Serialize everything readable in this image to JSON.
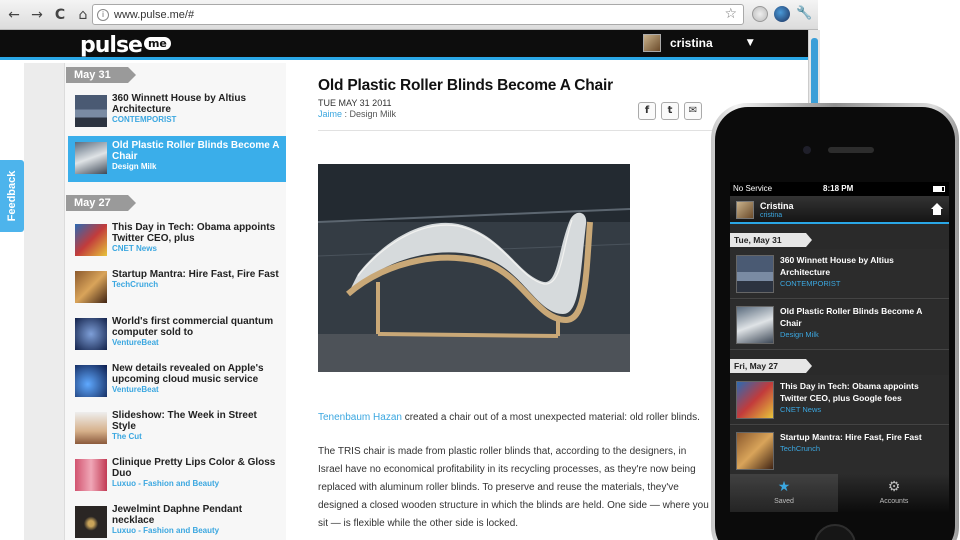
{
  "browser": {
    "url": "www.pulse.me/#",
    "back_icon": "←",
    "forward_icon": "→",
    "reload_icon": "C",
    "home_icon": "⌂",
    "star_icon": "☆",
    "wrench_icon": "🔧"
  },
  "header": {
    "logo_text": "pulse",
    "logo_badge": "me",
    "user_name": "cristina",
    "caret_icon": "▼"
  },
  "feedback": {
    "label": "Feedback"
  },
  "sidebar": {
    "date_1": "May 31",
    "date_2": "May 27",
    "stories": [
      {
        "title": "360 Winnett House by Altius Architecture",
        "source": "CONTEMPORIST",
        "thumb": "house"
      },
      {
        "title": "Old Plastic Roller Blinds Become A Chair",
        "source": "Design Milk",
        "thumb": "chair",
        "selected": true
      },
      {
        "title": "This Day in Tech: Obama appoints Twitter CEO, plus",
        "source": "CNET News",
        "thumb": "news"
      },
      {
        "title": "Startup Mantra: Hire Fast, Fire Fast",
        "source": "TechCrunch",
        "thumb": "startup"
      },
      {
        "title": "World's first commercial quantum computer sold to",
        "source": "VentureBeat",
        "thumb": "quantum"
      },
      {
        "title": "New details revealed on Apple's upcoming cloud music service",
        "source": "VentureBeat",
        "thumb": "cloud"
      },
      {
        "title": "Slideshow: The Week in Street Style",
        "source": "The Cut",
        "thumb": "street"
      },
      {
        "title": "Clinique Pretty Lips Color & Gloss Duo",
        "source": "Luxuo - Fashion and Beauty",
        "thumb": "lips"
      },
      {
        "title": "Jewelmint Daphne Pendant necklace",
        "source": "Luxuo - Fashion and Beauty",
        "thumb": "pendant"
      }
    ]
  },
  "article": {
    "title": "Old Plastic Roller Blinds Become A Chair",
    "date": "TUE MAY 31 2011",
    "author": "Jaime",
    "byline_sep": " : ",
    "publication": "Design Milk",
    "share_facebook": "f",
    "share_twitter": "t",
    "share_email": "✉",
    "p1_link": "Tenenbaum Hazan",
    "p1_rest": " created a chair out of a most unexpected material: old roller blinds.",
    "p2_lines": [
      "The TRIS chair is made from plastic roller blinds that, according to the designers, in",
      "Israel have no economical profitability in its recycling processes, as they're now being",
      "replaced with aluminum roller blinds. To preserve and reuse the materials, they've",
      "designed a closed wooden structure in which the blinds are held. One side — where you",
      "sit — is flexible while the other side is locked."
    ]
  },
  "phone": {
    "carrier": "No Service",
    "time": "8:18 PM",
    "user_name": "Cristina",
    "user_handle": "cristina",
    "date_1": "Tue, May 31",
    "date_2": "Fri, May 27",
    "stories": [
      {
        "title": "360 Winnett House by Altius Architecture",
        "source": "CONTEMPORIST",
        "thumb": "house"
      },
      {
        "title": "Old Plastic Roller Blinds Become A Chair",
        "source": "Design Milk",
        "thumb": "chair"
      },
      {
        "title": "This Day in Tech: Obama appoints Twitter CEO, plus Google foes",
        "source": "CNET News",
        "thumb": "news"
      },
      {
        "title": "Startup Mantra: Hire Fast, Fire Fast",
        "source": "TechCrunch",
        "thumb": "startup"
      }
    ],
    "tabs": [
      {
        "label": "Saved",
        "icon": "★",
        "active": true
      },
      {
        "label": "Accounts",
        "icon": "⚙",
        "active": false
      }
    ]
  },
  "colors": {
    "accent": "#3aaeea",
    "header_bg": "#0d0d0d",
    "selected_item": "#3aaeea"
  }
}
